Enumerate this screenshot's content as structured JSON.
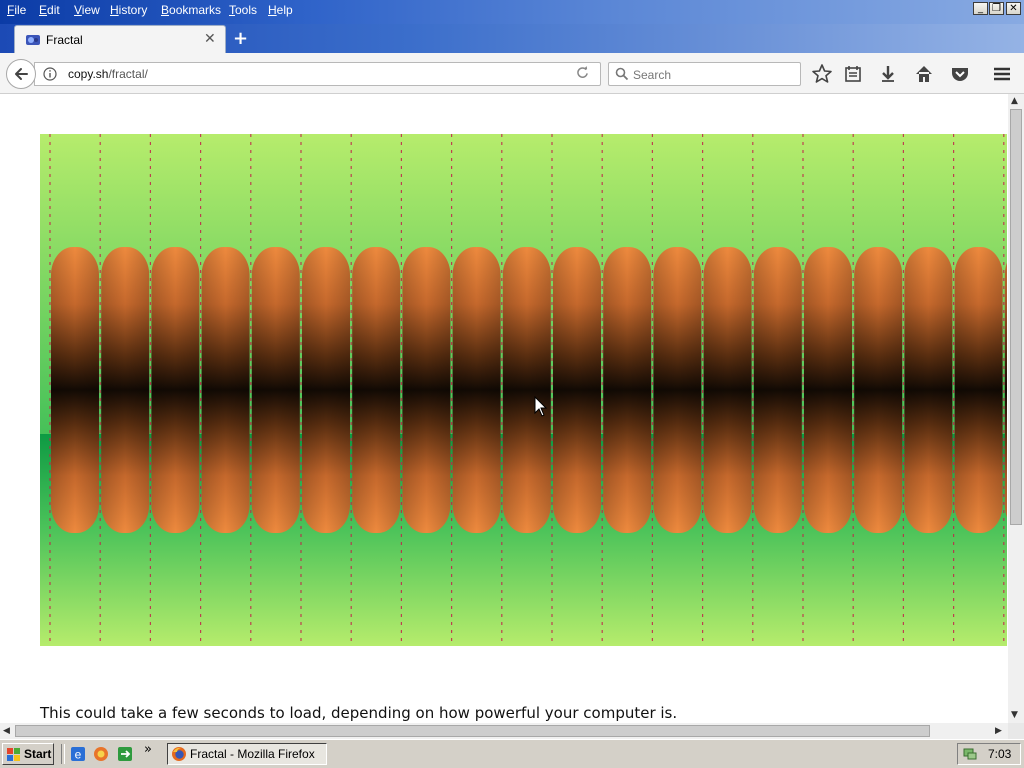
{
  "menubar": {
    "items": [
      {
        "label": "File",
        "key": "F",
        "rest": "ile"
      },
      {
        "label": "Edit",
        "key": "E",
        "rest": "dit"
      },
      {
        "label": "View",
        "key": "V",
        "rest": "iew"
      },
      {
        "label": "History",
        "key": "H",
        "rest": "istory"
      },
      {
        "label": "Bookmarks",
        "key": "B",
        "rest": "ookmarks"
      },
      {
        "label": "Tools",
        "key": "T",
        "rest": "ools"
      },
      {
        "label": "Help",
        "key": "H",
        "rest": "elp"
      }
    ],
    "window_buttons": {
      "minimize": "_",
      "restore": "❐",
      "close": "✕"
    }
  },
  "tab": {
    "title": "Fractal",
    "close": "✕",
    "new_tab": "+"
  },
  "navbar": {
    "url_host": "copy.sh",
    "url_path": "/fractal/",
    "search_placeholder": "Search"
  },
  "content": {
    "caption": "This could take a few seconds to load, depending on how powerful your computer is."
  },
  "taskbar": {
    "start_label": "Start",
    "more": "»",
    "task_label": "Fractal - Mozilla Firefox",
    "clock": "7:03"
  },
  "colors": {
    "green_dark": "#0e9a43",
    "green_light": "#b6ec6c",
    "orange": "#ee8a3e",
    "dark_center": "#120a04",
    "spike": "#c2234a"
  }
}
